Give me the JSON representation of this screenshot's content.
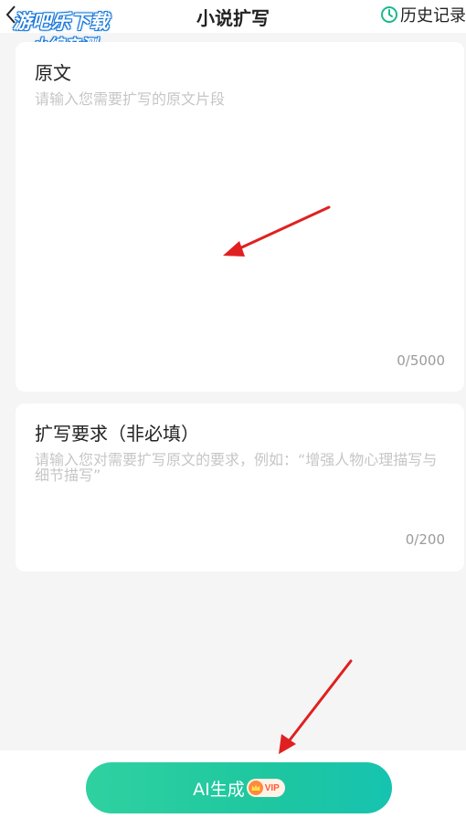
{
  "header": {
    "title": "小说扩写",
    "history_label": "历史记录",
    "back_icon": "chevron-left-icon",
    "history_icon": "clock-icon"
  },
  "watermark": {
    "line1": "游吧乐下载",
    "line2": "小编亲测"
  },
  "original_card": {
    "label": "原文",
    "value": "",
    "placeholder": "请输入您需要扩写的原文片段",
    "counter": "0/5000"
  },
  "requirement_card": {
    "label": "扩写要求（非必填）",
    "value": "",
    "placeholder": "请输入您对需要扩写原文的要求，例如：“增强人物心理描写与细节描写”",
    "counter": "0/200"
  },
  "generate_button": {
    "label": "AI生成",
    "badge": "VIP",
    "badge_icon": "crown-icon"
  },
  "colors": {
    "button_gradient_start": "#2fd1a0",
    "button_gradient_end": "#16c3b0",
    "annotation_arrow": "#e02020",
    "placeholder": "#c6c6c6",
    "background": "#f5f5f5"
  }
}
